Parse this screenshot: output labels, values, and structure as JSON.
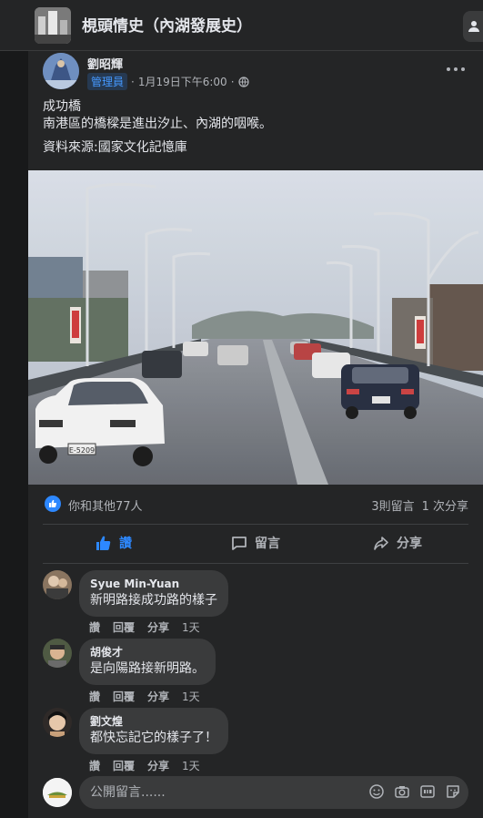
{
  "group": {
    "title": "梘頭情史（內湖發展史）"
  },
  "post": {
    "author": "劉昭輝",
    "role_badge": "管理員",
    "timestamp": "1月19日下午6:00",
    "separator": "·",
    "text_lines": [
      "成功橋",
      "南港區的橋樑是進出汐止、內湖的咽喉。",
      "",
      "資料來源:國家文化記憶庫"
    ]
  },
  "stats": {
    "likes": "你和其他77人",
    "comments_count": "3則留言",
    "shares_count": "1 次分享"
  },
  "actions": {
    "like": "讚",
    "comment": "留言",
    "share": "分享"
  },
  "comments": [
    {
      "name": "Syue Min-Yuan",
      "text": "新明路接成功路的樣子",
      "like": "讚",
      "reply": "回覆",
      "share": "分享",
      "time": "1天"
    },
    {
      "name": "胡俊才",
      "text": "是向陽路接新明路。",
      "like": "讚",
      "reply": "回覆",
      "share": "分享",
      "time": "1天"
    },
    {
      "name": "劉文煌",
      "text": "都快忘記它的樣子了！",
      "like": "讚",
      "reply": "回覆",
      "share": "分享",
      "time": "1天"
    }
  ],
  "composer": {
    "placeholder": "公開留言......"
  },
  "photo_plates": [
    "E-5209"
  ]
}
